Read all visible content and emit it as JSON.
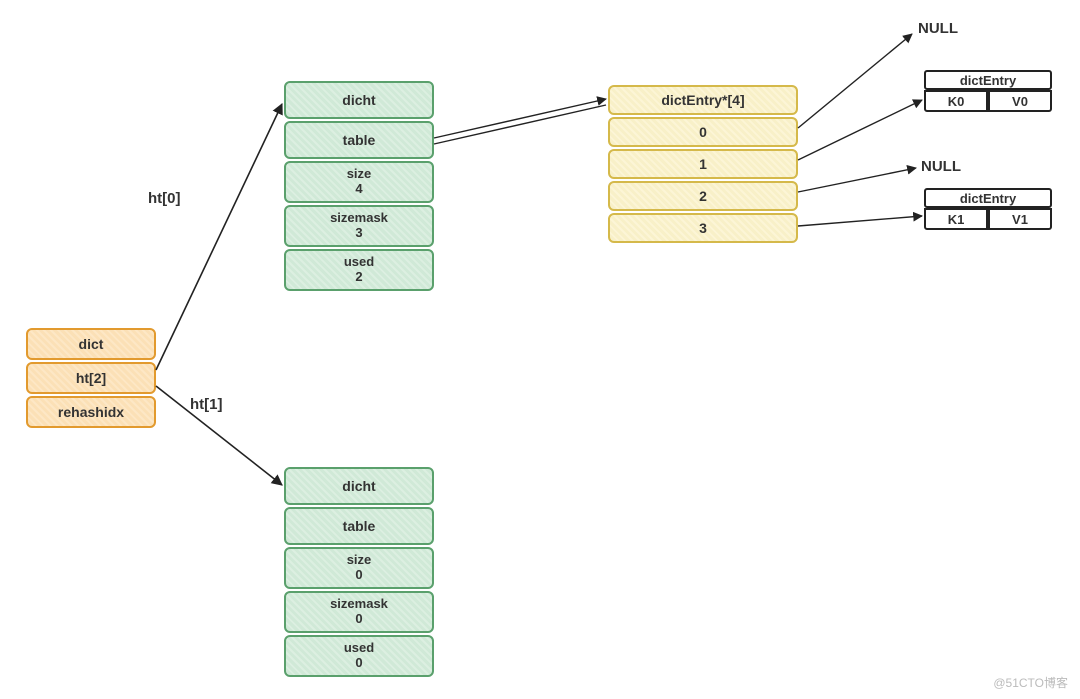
{
  "dict": {
    "title": "dict",
    "ht": "ht[2]",
    "rehashidx": "rehashidx"
  },
  "edges": {
    "ht0": "ht[0]",
    "ht1": "ht[1]"
  },
  "ht0": {
    "title": "dicht",
    "table": "table",
    "size_label": "size",
    "size_value": "4",
    "sizemask_label": "sizemask",
    "sizemask_value": "3",
    "used_label": "used",
    "used_value": "2"
  },
  "ht1": {
    "title": "dicht",
    "table": "table",
    "size_label": "size",
    "size_value": "0",
    "sizemask_label": "sizemask",
    "sizemask_value": "0",
    "used_label": "used",
    "used_value": "0"
  },
  "bucket": {
    "header": "dictEntry*[4]",
    "slots": [
      "0",
      "1",
      "2",
      "3"
    ]
  },
  "targets": {
    "null_a": "NULL",
    "null_b": "NULL"
  },
  "entry0": {
    "title": "dictEntry",
    "key": "K0",
    "value": "V0"
  },
  "entry1": {
    "title": "dictEntry",
    "key": "K1",
    "value": "V1"
  },
  "watermark": "@51CTO博客"
}
